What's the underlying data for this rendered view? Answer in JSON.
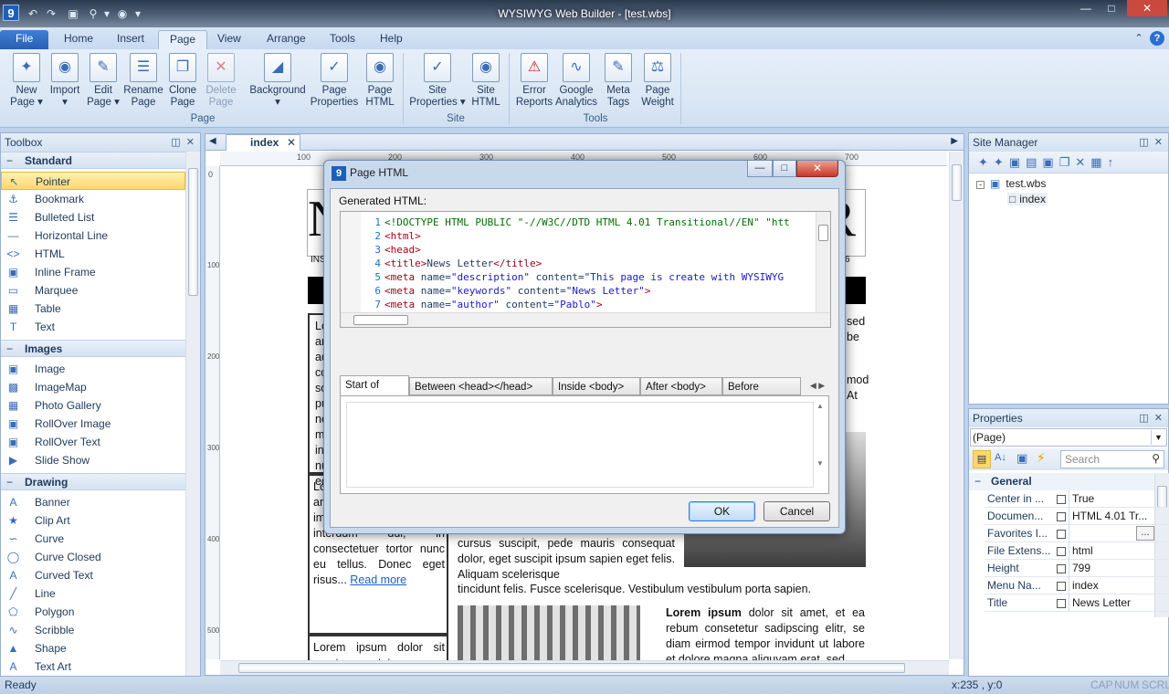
{
  "window": {
    "title": "WYSIWYG Web Builder - [test.wbs]",
    "app_icon_text": "9",
    "controls": {
      "minimize": "—",
      "maximize": "□",
      "close": "✕"
    }
  },
  "ribbon_tabs": [
    "File",
    "Home",
    "Insert",
    "Page",
    "View",
    "Arrange",
    "Tools",
    "Help"
  ],
  "ribbon": {
    "page_group": {
      "label": "Page",
      "buttons": [
        {
          "line1": "New",
          "line2": "Page ▾",
          "icon": "new-page-icon"
        },
        {
          "line1": "Import",
          "line2": "▾",
          "icon": "import-icon"
        },
        {
          "line1": "Edit",
          "line2": "Page ▾",
          "icon": "edit-page-icon"
        },
        {
          "line1": "Rename",
          "line2": "Page",
          "icon": "rename-page-icon"
        },
        {
          "line1": "Clone",
          "line2": "Page",
          "icon": "clone-page-icon"
        },
        {
          "line1": "Delete",
          "line2": "Page",
          "icon": "delete-page-icon"
        },
        {
          "line1": "Background",
          "line2": "▾",
          "icon": "background-icon"
        },
        {
          "line1": "Page",
          "line2": "Properties",
          "icon": "page-properties-icon"
        },
        {
          "line1": "Page",
          "line2": "HTML",
          "icon": "page-html-icon"
        }
      ]
    },
    "site_group": {
      "label": "Site",
      "buttons": [
        {
          "line1": "Site",
          "line2": "Properties ▾",
          "icon": "site-properties-icon"
        },
        {
          "line1": "Site",
          "line2": "HTML",
          "icon": "site-html-icon"
        }
      ]
    },
    "tools_group": {
      "label": "Tools",
      "buttons": [
        {
          "line1": "Error",
          "line2": "Reports",
          "icon": "error-reports-icon"
        },
        {
          "line1": "Google",
          "line2": "Analytics",
          "icon": "google-analytics-icon"
        },
        {
          "line1": "Meta",
          "line2": "Tags",
          "icon": "meta-tags-icon"
        },
        {
          "line1": "Page",
          "line2": "Weight",
          "icon": "page-weight-icon"
        }
      ]
    }
  },
  "toolbox": {
    "title": "Toolbox",
    "sections": [
      {
        "name": "Standard",
        "items": [
          "Pointer",
          "Bookmark",
          "Bulleted List",
          "Horizontal Line",
          "HTML",
          "Inline Frame",
          "Marquee",
          "Table",
          "Text"
        ]
      },
      {
        "name": "Images",
        "items": [
          "Image",
          "ImageMap",
          "Photo Gallery",
          "RollOver Image",
          "RollOver Text",
          "Slide Show"
        ]
      },
      {
        "name": "Drawing",
        "items": [
          "Banner",
          "Clip Art",
          "Curve",
          "Curve Closed",
          "Curved Text",
          "Line",
          "Polygon",
          "Scribble",
          "Shape",
          "Text Art"
        ]
      }
    ],
    "selected": "Pointer"
  },
  "document": {
    "tab": "index",
    "ruler_marks": [
      "100",
      "200",
      "300",
      "400",
      "500",
      "600",
      "700"
    ],
    "vruler_marks": [
      "0",
      "100",
      "200",
      "300",
      "400",
      "500"
    ],
    "heading_left": "N",
    "heading_right": "R",
    "ins_text": "INS",
    "ins_right": "6",
    "col1_text1": "Lo am ad co so pu ne ma in nu eg",
    "col1_text2": "Lo am ad co sollicitudin, ante nec pulvinar imperdiet, magna mi interdum dui, in consectetuer tortor nunc eu tellus. Donec eget risus...",
    "read_more": "Read more",
    "col1_text3": "Lorem ipsum dolor sit amet consectetuer",
    "right_frag1": "sed be",
    "right_frag2": "mod At",
    "mid_text": "cursus suscipit, pede mauris consequat dolor, eget suscipit ipsum sapien eget felis. Aliquam scelerisque",
    "wide_text": "tincidunt felis. Fusce scelerisque. Vestibulum vestibulum porta sapien.",
    "lorem_bold": "Lorem ipsum",
    "lorem_text": " dolor sit amet, et ea rebum consetetur sadipscing elitr, se diam eirmod tempor invidunt ut labore et dolore magna aliquyam erat, sed"
  },
  "dialog": {
    "title": "Page HTML",
    "generated_label": "Generated HTML:",
    "code_lines": [
      {
        "n": "1",
        "html": "<span class='g'>&lt;!DOCTYPE HTML PUBLIC \"-//W3C//DTD HTML 4.01 Transitional//EN\" \"htt</span>"
      },
      {
        "n": "2",
        "html": "<span class='k'>&lt;html&gt;</span>"
      },
      {
        "n": "3",
        "html": "<span class='k'>&lt;head&gt;</span>"
      },
      {
        "n": "4",
        "html": "<span class='k'>&lt;title&gt;</span>News Letter<span class='k'>&lt;/title&gt;</span>"
      },
      {
        "n": "5",
        "html": "<span class='k'>&lt;meta</span> name=<span class='a'>\"description\"</span> content=<span class='a'>\"This page is create with WYSIWYG</span>"
      },
      {
        "n": "6",
        "html": "<span class='k'>&lt;meta</span> name=<span class='a'>\"keywords\"</span> content=<span class='a'>\"News Letter\"</span><span class='k'>&gt;</span>"
      },
      {
        "n": "7",
        "html": "<span class='k'>&lt;meta</span> name=<span class='a'>\"author\"</span> content=<span class='a'>\"Pablo\"</span><span class='k'>&gt;</span>"
      }
    ],
    "tabs": [
      "Start of Page",
      "Between <head></head> tags",
      "Inside <body> tag",
      "After <body> tag",
      "Before </body>"
    ],
    "active_tab": "Start of Page",
    "ok": "OK",
    "cancel": "Cancel"
  },
  "site_manager": {
    "title": "Site Manager",
    "root": "test.wbs",
    "child": "index"
  },
  "properties": {
    "title": "Properties",
    "object": "(Page)",
    "search_placeholder": "Search",
    "category": "General",
    "rows": [
      {
        "name": "Center in ...",
        "value": "True"
      },
      {
        "name": "Documen...",
        "value": "HTML 4.01 Tr..."
      },
      {
        "name": "Favorites I...",
        "value": ""
      },
      {
        "name": "File Extens...",
        "value": "html"
      },
      {
        "name": "Height",
        "value": "799"
      },
      {
        "name": "Menu Na...",
        "value": "index"
      },
      {
        "name": "Title",
        "value": "News Letter"
      }
    ]
  },
  "statusbar": {
    "left": "Ready",
    "coords": "x:235 , y:0",
    "caps": "CAP",
    "num": "NUM",
    "scrl": "SCRL"
  }
}
